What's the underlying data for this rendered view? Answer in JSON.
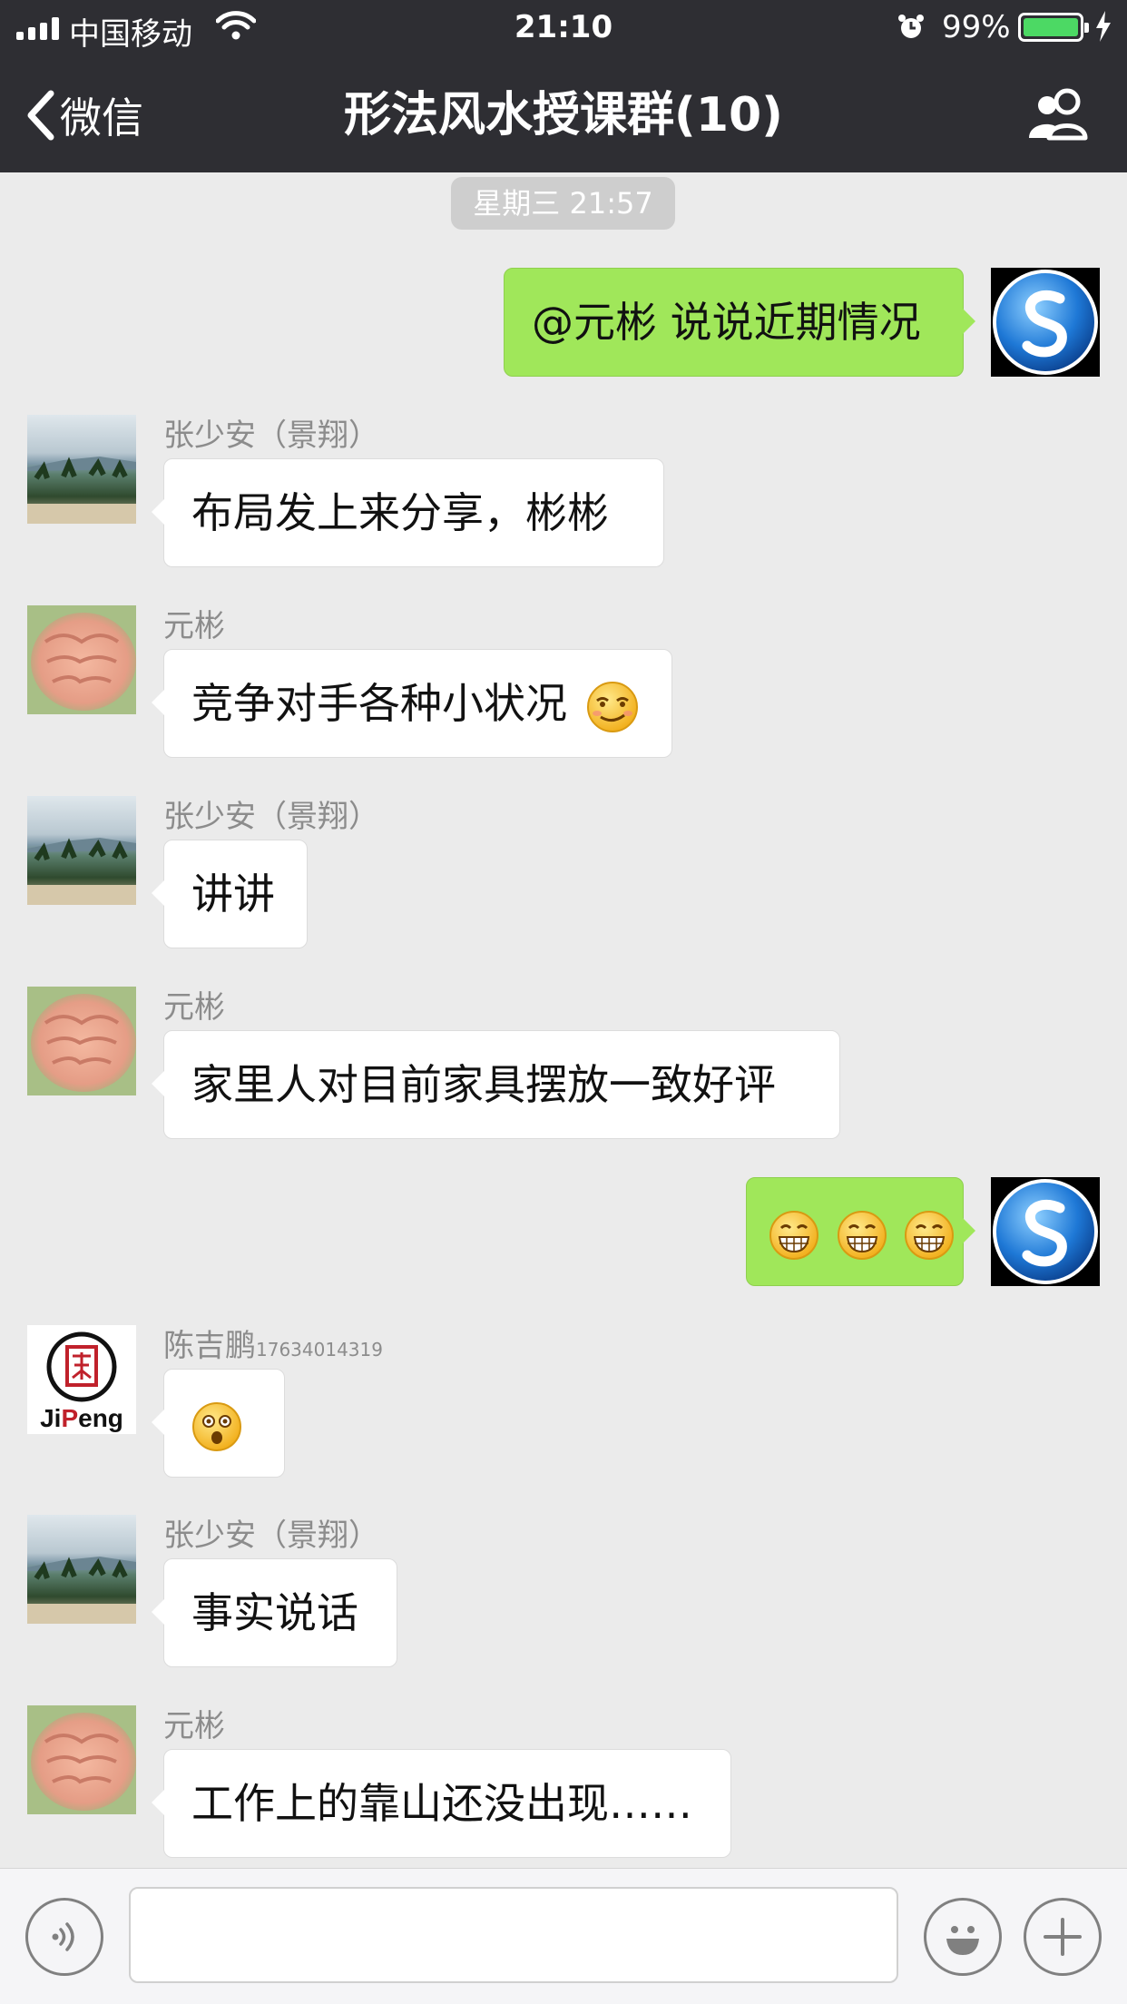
{
  "status_bar": {
    "carrier": "中国移动",
    "time": "21:10",
    "battery_pct": "99%"
  },
  "nav": {
    "back_label": "微信",
    "title": "形法风水授课群(10)"
  },
  "chat": {
    "timestamp": "星期三 21:57",
    "messages": [
      {
        "side": "right",
        "text": "@元彬 说说近期情况"
      },
      {
        "side": "left",
        "sender": "张少安（景翔）",
        "text": "布局发上来分享，彬彬"
      },
      {
        "side": "left",
        "sender": "元彬",
        "text": "竞争对手各种小状况",
        "emoji": "smirk-emoji"
      },
      {
        "side": "left",
        "sender": "张少安（景翔）",
        "text": "讲讲"
      },
      {
        "side": "left",
        "sender": "元彬",
        "text": "家里人对目前家具摆放一致好评"
      },
      {
        "side": "right",
        "text": "",
        "emoji": "grin-emoji x3"
      },
      {
        "side": "left",
        "sender": "陈吉鹏",
        "sender_suffix": "17634014319",
        "text": "",
        "emoji": "shocked-emoji"
      },
      {
        "side": "left",
        "sender": "张少安（景翔）",
        "text": "事实说话"
      },
      {
        "side": "left",
        "sender": "元彬",
        "text": "工作上的靠山还没出现……"
      }
    ]
  },
  "avatars": {
    "jipeng_logo_text": "JiPeng"
  },
  "colors": {
    "nav_bg": "#2e2e33",
    "chat_bg": "#ebebeb",
    "my_bubble": "#a0e75a",
    "battery_fill": "#4cd964"
  }
}
